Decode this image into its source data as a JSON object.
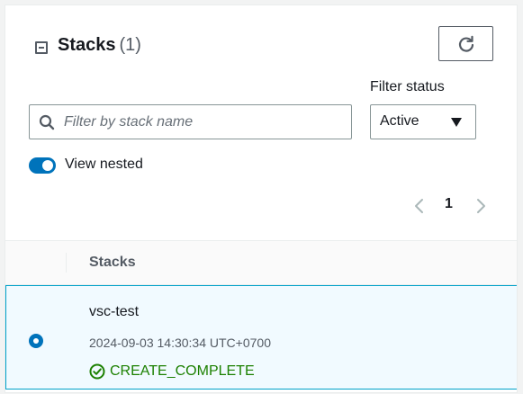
{
  "header": {
    "title": "Stacks",
    "count": "(1)"
  },
  "filter": {
    "search_placeholder": "Filter by stack name",
    "status_label": "Filter status",
    "status_value": "Active"
  },
  "toggle": {
    "label": "View nested",
    "enabled": true
  },
  "pagination": {
    "current_page": "1"
  },
  "table": {
    "column_header": "Stacks",
    "rows": [
      {
        "name": "vsc-test",
        "timestamp": "2024-09-03 14:30:34 UTC+0700",
        "status": "CREATE_COMPLETE",
        "selected": true
      }
    ]
  },
  "colors": {
    "accent": "#0073bb",
    "success": "#1d8102",
    "selected_row_bg": "#f1faff",
    "selected_row_border": "#00a1c9"
  },
  "icons": {
    "collapse": "collapse-icon",
    "refresh": "refresh-icon",
    "search": "search-icon",
    "caret": "caret-down-icon",
    "prev": "chevron-left-icon",
    "next": "chevron-right-icon",
    "status": "check-circle-icon"
  }
}
